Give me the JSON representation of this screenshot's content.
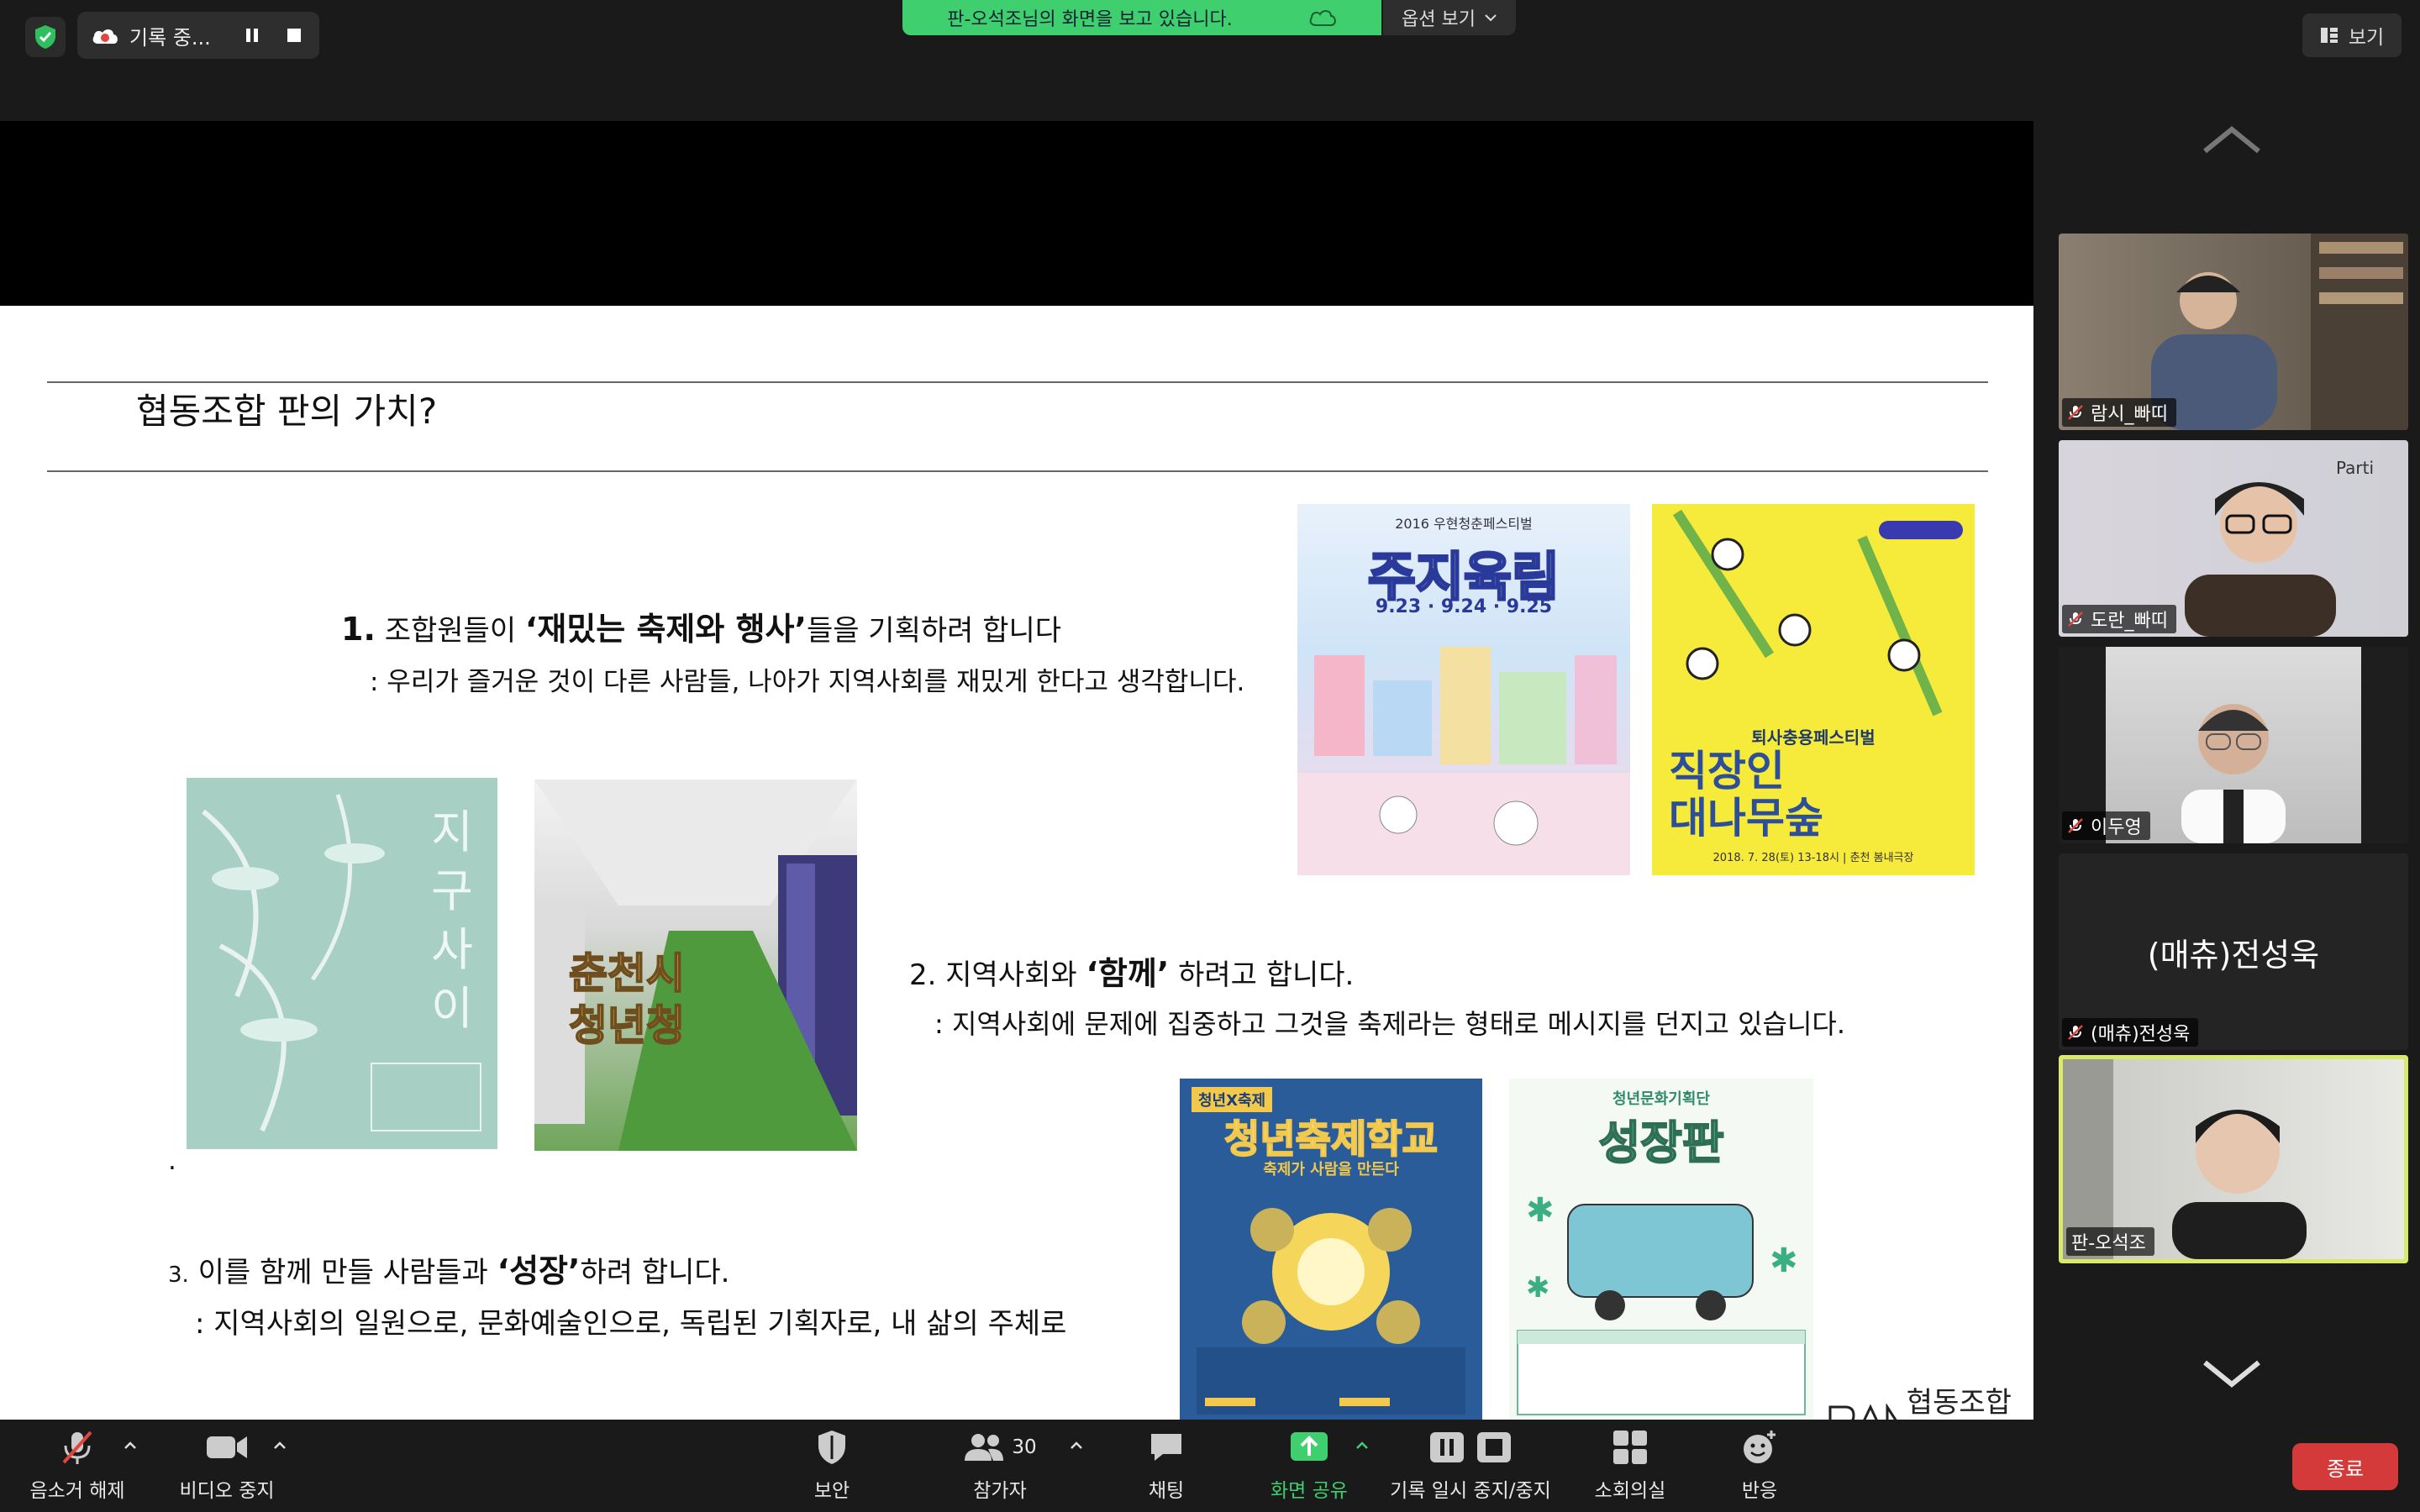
{
  "topbar": {
    "recording_label": "기록 중...",
    "share_banner": "판-오석조님의 화면을 보고 있습니다.",
    "view_options": "옵션 보기",
    "view_label": "보기"
  },
  "slide": {
    "title": "협동조합 판의 가치?",
    "point1_num": "1.",
    "point1_pre": "조합원들이 ",
    "point1_bold": "‘재밌는 축제와 행사’",
    "point1_post": "들을 기획하려 합니다",
    "point1_sub": ": 우리가 즐거운 것이 다른 사람들, 나아가 지역사회를 재밌게 한다고 생각합니다.",
    "point2_pre": "2. 지역사회와 ",
    "point2_bold": "‘함께’",
    "point2_post": " 하려고 합니다.",
    "point2_sub": ": 지역사회에 문제에 집중하고 그것을 축제라는 형태로 메시지를 던지고 있습니다.",
    "dot": ".",
    "point3_num": "3.",
    "point3_pre": " 이를 함께 만들 사람들과 ",
    "point3_bold": "‘성장’",
    "point3_post": "하려 합니다.",
    "point3_sub": ": 지역사회의 일원으로, 문화예술인으로, 독립된 기획자로, 내 삶의 주체로",
    "logo_text": "협동조합 판",
    "posters": {
      "p1_top": "2016 우현청춘페스티벌",
      "p1_title": "주지육림",
      "p1_dates": "9.23 · 9.24 · 9.25",
      "p2_sub": "퇴사충용페스티벌",
      "p2_title": "직장인 대나무숲",
      "p2_date": "2018. 7. 28(토) 13-18시 | 춘천 봄내극장",
      "p3_title": "지구사이",
      "p4_title": "춘천시 청년청",
      "p5_tag": "청년X축제",
      "p5_title": "청년축제학교",
      "p5_sub": "축제가 사람을 만든다",
      "p6_sub": "청년문화기획단",
      "p6_title": "성장판"
    }
  },
  "participants": [
    {
      "name": "람시_빠띠",
      "muted": true
    },
    {
      "name": "도란_빠띠",
      "muted": true
    },
    {
      "name": "이두영",
      "muted": true
    },
    {
      "name": "(매츄)전성욱",
      "muted": true
    },
    {
      "name": "판-오석조",
      "muted": false
    }
  ],
  "toolbar": {
    "unmute": "음소거 해제",
    "stop_video": "비디오 중지",
    "security": "보안",
    "participants": "참가자",
    "participants_count": "30",
    "chat": "채팅",
    "share_screen": "화면 공유",
    "pause_recording": "기록 일시 중지/중지",
    "breakout": "소회의실",
    "reactions": "반응",
    "end": "종료"
  },
  "colors": {
    "share_green": "#3fcf6e",
    "end_red": "#d43a3a",
    "active_speaker": "#d9e96b"
  }
}
